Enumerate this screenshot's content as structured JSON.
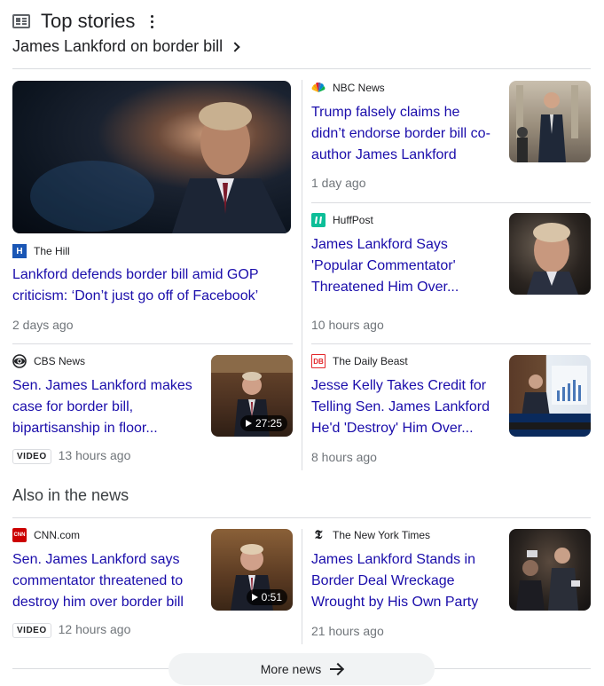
{
  "header": {
    "title": "Top stories",
    "subheading": "James Lankford on border bill"
  },
  "stories": [
    {
      "source": "The Hill",
      "headline": "Lankford defends border bill amid GOP criticism: ‘Don’t just go off of Facebook’",
      "time": "2 days ago"
    },
    {
      "source": "NBC News",
      "headline": "Trump falsely claims he didn’t endorse border bill co-author James Lankford",
      "time": "1 day ago"
    },
    {
      "source": "HuffPost",
      "headline": "James Lankford Says 'Popular Commentator' Threatened Him Over...",
      "time": "10 hours ago"
    },
    {
      "source": "CBS News",
      "headline": "Sen. James Lankford makes case for border bill, bipartisanship in floor...",
      "time": "13 hours ago",
      "badge": "VIDEO",
      "duration": "27:25"
    },
    {
      "source": "The Daily Beast",
      "headline": "Jesse Kelly Takes Credit for Telling Sen. James Lankford He'd 'Destroy' Him Over...",
      "time": "8 hours ago"
    }
  ],
  "also": {
    "title": "Also in the news",
    "stories": [
      {
        "source": "CNN.com",
        "headline": "Sen. James Lankford says commentator threatened to destroy him over border bill",
        "time": "12 hours ago",
        "badge": "VIDEO",
        "duration": "0:51"
      },
      {
        "source": "The New York Times",
        "headline": "James Lankford Stands in Border Deal Wreckage Wrought by His Own Party",
        "time": "21 hours ago"
      }
    ]
  },
  "more_button": {
    "label": "More news"
  },
  "logos": {
    "the_hill": "H",
    "huffpost": "",
    "daily_beast": "DB",
    "cnn": "CNN",
    "nyt": "𝕿"
  },
  "colors": {
    "link": "#1a0dab",
    "meta": "#70757a",
    "divider": "#dadce0"
  }
}
